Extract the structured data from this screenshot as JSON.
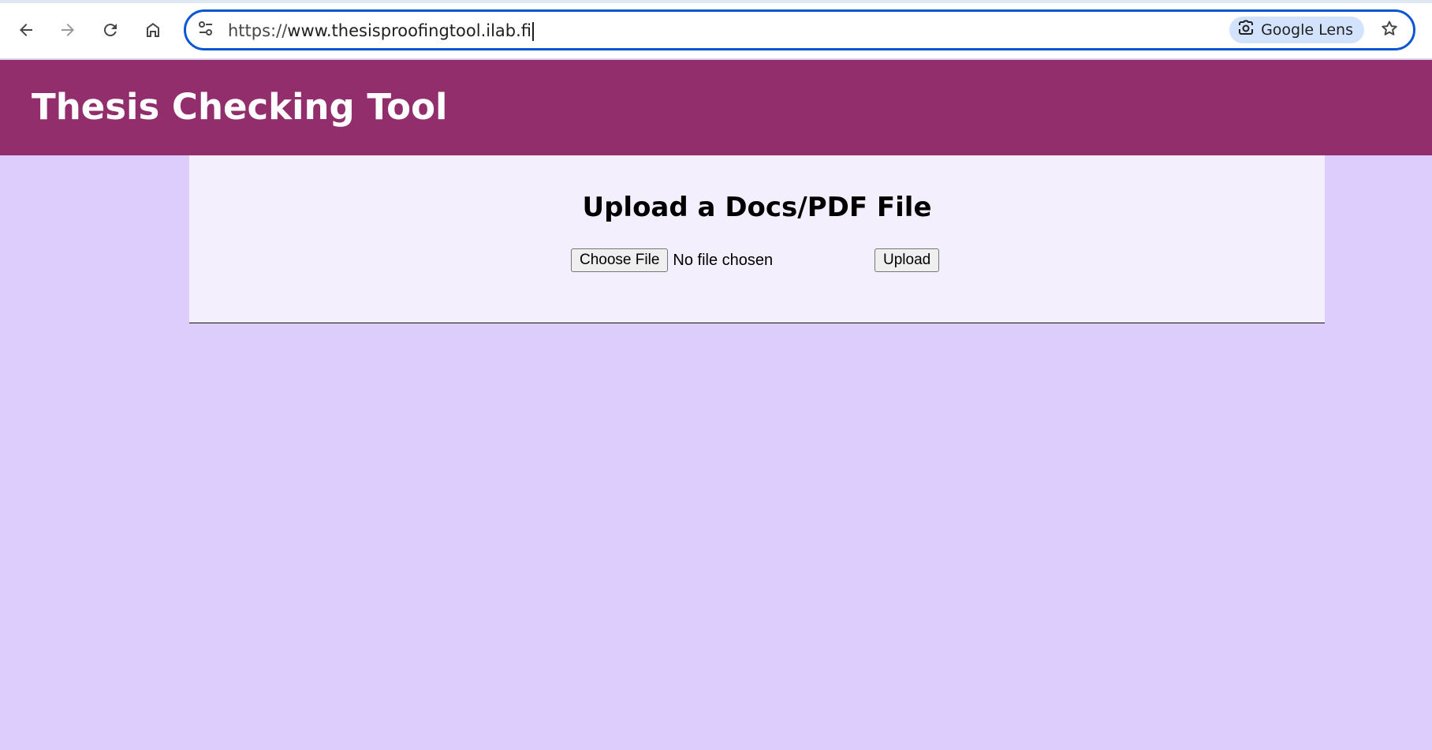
{
  "browser": {
    "url_protocol": "https://",
    "url_host": "www.thesisproofingtool.ilab.fi",
    "lens_label": "Google Lens",
    "icons": {
      "back": "back-arrow-icon",
      "forward": "forward-arrow-icon",
      "reload": "reload-icon",
      "home": "home-icon",
      "site_info": "tune-icon",
      "lens": "google-lens-icon",
      "bookmark": "star-icon"
    }
  },
  "header": {
    "title": "Thesis Checking Tool"
  },
  "upload": {
    "heading": "Upload a Docs/PDF File",
    "choose_label": "Choose File",
    "status": "No file chosen",
    "submit_label": "Upload"
  },
  "colors": {
    "header_bg": "#922e6c",
    "page_bg": "#ddcdfd",
    "panel_bg": "#f3effd",
    "omnibox_focus": "#0b57d0",
    "lens_chip": "#d3e3fd"
  }
}
